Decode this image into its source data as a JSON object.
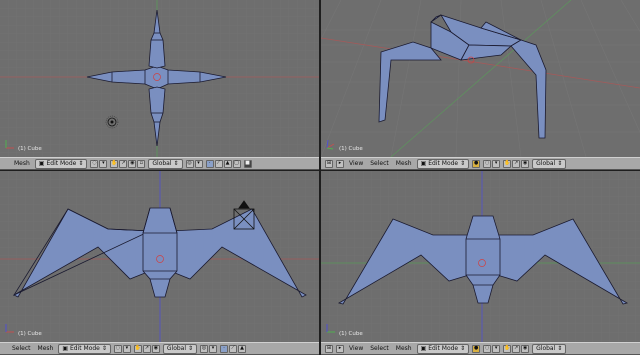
{
  "colors": {
    "mesh_fill": "#7a8fc0",
    "mesh_edge": "#1a1a30",
    "bg": "#6e6e6e",
    "grid": "#747474",
    "axis_x": "#b05050",
    "axis_y": "#50a050",
    "axis_z": "#5050d0"
  },
  "viewports": [
    {
      "id": "top-left",
      "object_label": "(1) Cube",
      "header": {
        "menus": [
          "Mesh"
        ],
        "mode": "Edit Mode",
        "orientation": "Global"
      }
    },
    {
      "id": "top-right",
      "object_label": "(1) Cube",
      "header": {
        "menus": [
          "View",
          "Select",
          "Mesh"
        ],
        "mode": "Edit Mode",
        "orientation": "Global"
      }
    },
    {
      "id": "bottom-left",
      "object_label": "(1) Cube",
      "header": {
        "menus": [
          "Select",
          "Mesh"
        ],
        "mode": "Edit Mode",
        "orientation": "Global"
      }
    },
    {
      "id": "bottom-right",
      "object_label": "(1) Cube",
      "header": {
        "menus": [
          "View",
          "Select",
          "Mesh"
        ],
        "mode": "Edit Mode",
        "orientation": "Global"
      }
    }
  ],
  "icons": [
    "view-type-icon",
    "mode-cube-icon",
    "pivot-icon",
    "manipulator-hand-icon",
    "layer-icon",
    "snap-icon",
    "render-icon"
  ]
}
